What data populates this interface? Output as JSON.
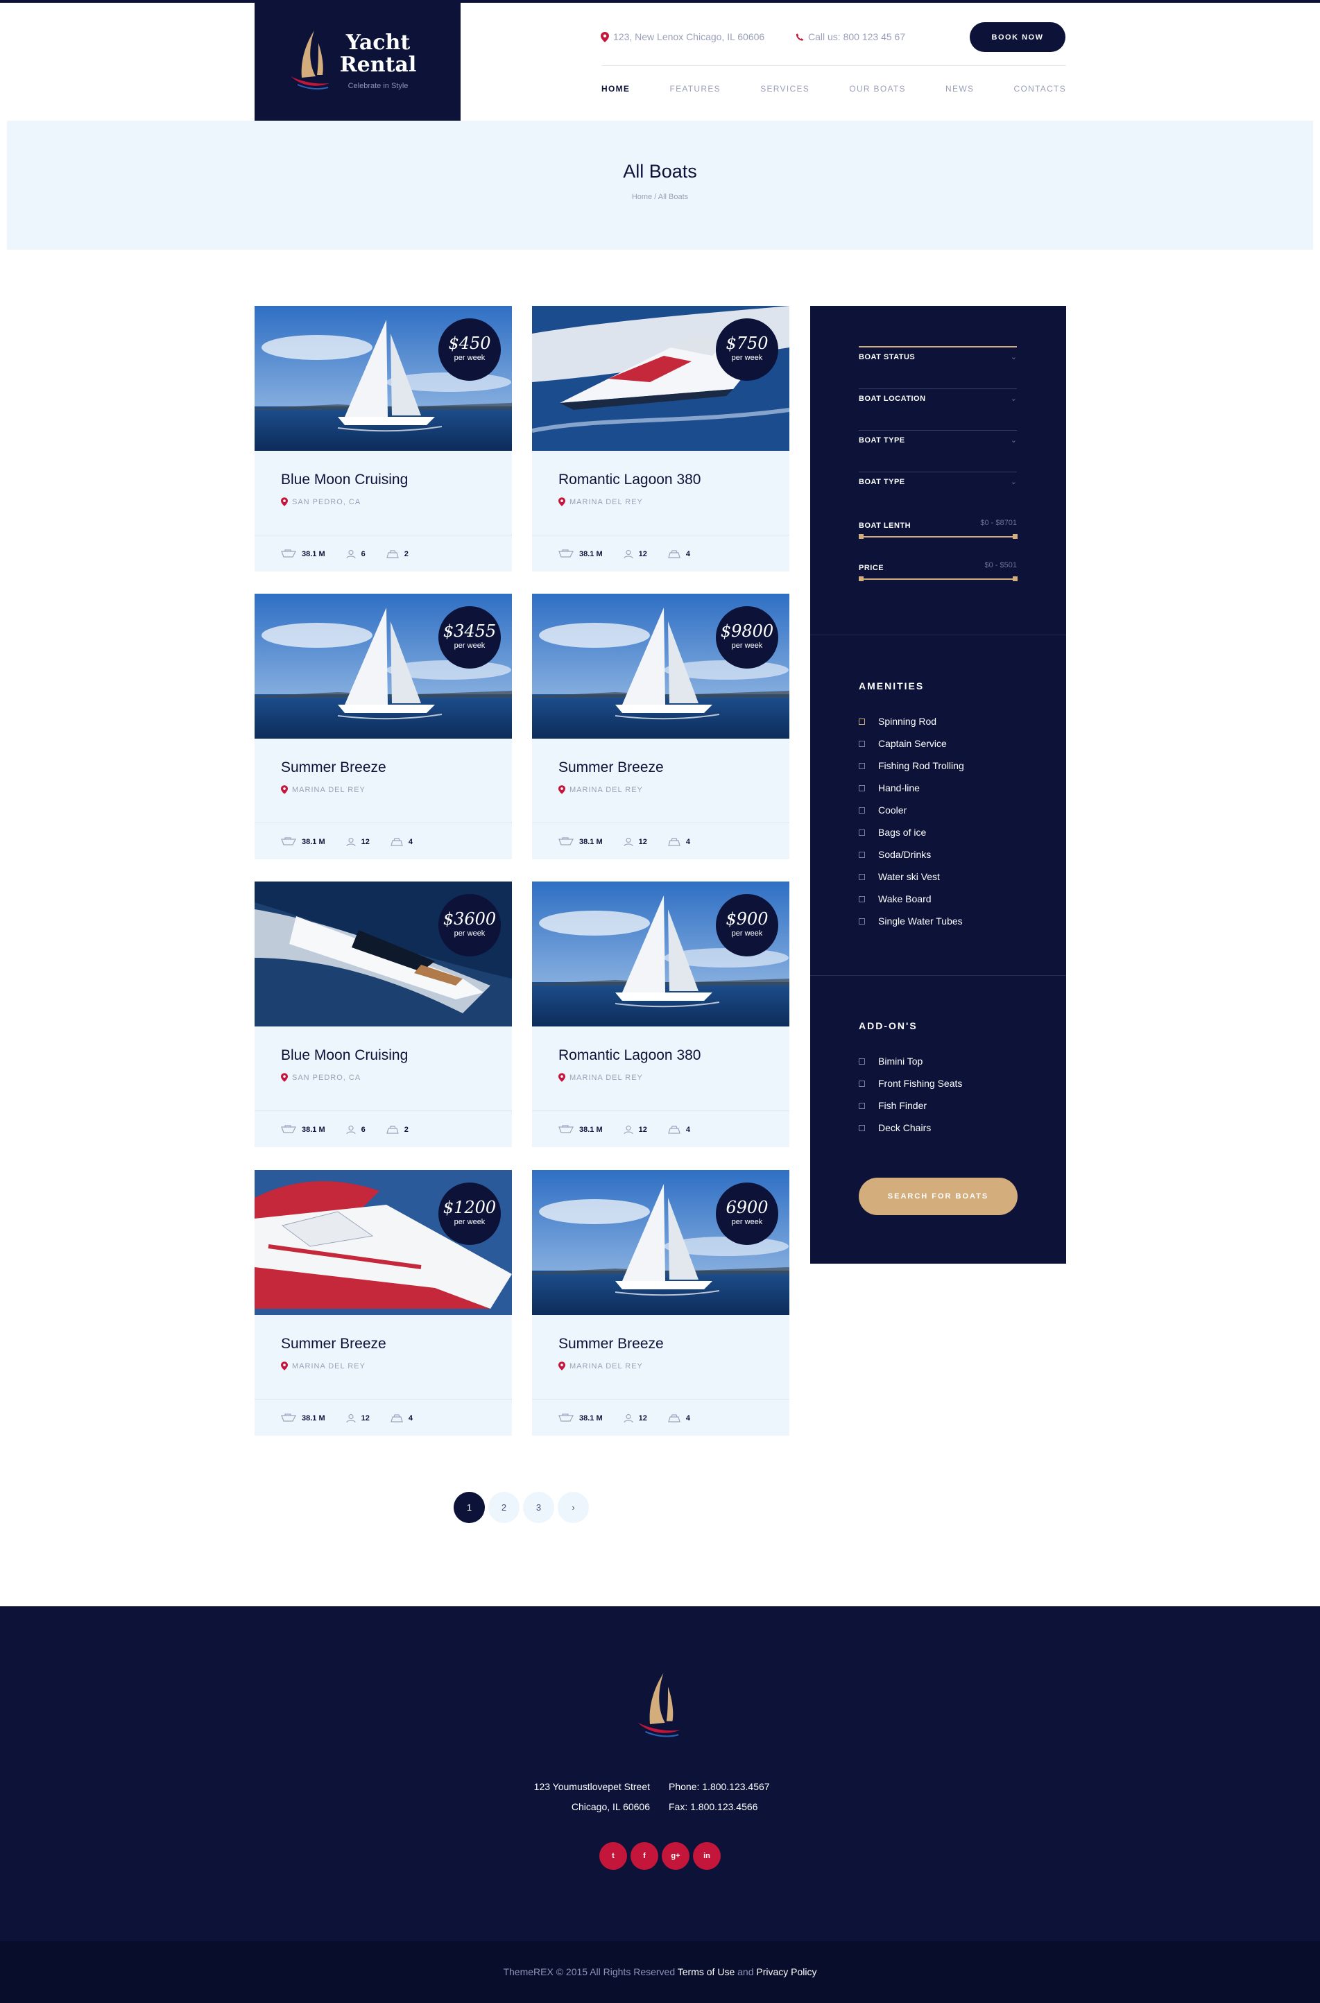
{
  "brand": {
    "name_line1": "Yacht",
    "name_line2": "Rental",
    "tagline": "Celebrate in Style"
  },
  "header": {
    "address": "123, New Lenox Chicago, IL 60606",
    "phone": "Call us: 800 123 45 67",
    "book_label": "BOOK NOW",
    "nav": [
      "HOME",
      "FEATURES",
      "SERVICES",
      "OUR BOATS",
      "NEWS",
      "CONTACTS"
    ],
    "active_nav": "HOME"
  },
  "page": {
    "title": "All Boats",
    "breadcrumb": "Home / All Boats"
  },
  "boats": [
    {
      "name": "Blue Moon Cruising",
      "location": "SAN PEDRO, CA",
      "price": "$450",
      "per": "per week",
      "length": "38.1 M",
      "guests": "6",
      "cabins": "2",
      "image": "sailboat"
    },
    {
      "name": "Romantic Lagoon 380",
      "location": "MARINA DEL REY",
      "price": "$750",
      "per": "per week",
      "length": "38.1 M",
      "guests": "12",
      "cabins": "4",
      "image": "speedboat"
    },
    {
      "name": "Summer Breeze",
      "location": "MARINA DEL REY",
      "price": "$3455",
      "per": "per week",
      "length": "38.1 M",
      "guests": "12",
      "cabins": "4",
      "image": "sailboat"
    },
    {
      "name": "Summer Breeze",
      "location": "MARINA DEL REY",
      "price": "$9800",
      "per": "per week",
      "length": "38.1 M",
      "guests": "12",
      "cabins": "4",
      "image": "sailboat"
    },
    {
      "name": "Blue Moon Cruising",
      "location": "SAN PEDRO, CA",
      "price": "$3600",
      "per": "per week",
      "length": "38.1 M",
      "guests": "6",
      "cabins": "2",
      "image": "yacht"
    },
    {
      "name": "Romantic Lagoon 380",
      "location": "MARINA DEL REY",
      "price": "$900",
      "per": "per week",
      "length": "38.1 M",
      "guests": "12",
      "cabins": "4",
      "image": "sailboat"
    },
    {
      "name": "Summer Breeze",
      "location": "MARINA DEL REY",
      "price": "$1200",
      "per": "per week",
      "length": "38.1 M",
      "guests": "12",
      "cabins": "4",
      "image": "redboat"
    },
    {
      "name": "Summer Breeze",
      "location": "MARINA DEL REY",
      "price": "6900",
      "per": "per week",
      "length": "38.1 M",
      "guests": "12",
      "cabins": "4",
      "image": "sailboat"
    }
  ],
  "filters": {
    "selects": [
      "BOAT STATUS",
      "BOAT LOCATION",
      "BOAT TYPE",
      "BOAT TYPE"
    ],
    "length": {
      "label": "BOAT LENTH",
      "value": "$0 - $8701",
      "fraction": 1.0
    },
    "price": {
      "label": "PRICE",
      "value": "$0 - $501",
      "fraction": 1.0
    },
    "amenities_title": "AMENITIES",
    "amenities": [
      "Spinning Rod",
      "Captain Service",
      "Fishing Rod Trolling",
      "Hand-line",
      "Cooler",
      "Bags of ice",
      "Soda/Drinks",
      "Water ski Vest",
      "Wake Board",
      "Single Water Tubes"
    ],
    "addons_title": "ADD-ON'S",
    "addons": [
      "Bimini Top",
      "Front Fishing Seats",
      "Fish Finder",
      "Deck Chairs"
    ],
    "search_label": "SEARCH FOR BOATS"
  },
  "pagination": {
    "pages": [
      "1",
      "2",
      "3"
    ],
    "next": "›",
    "current": "1"
  },
  "footer": {
    "street": "123 Youmustlovepet Street",
    "city": "Chicago, IL 60606",
    "phone": "Phone: 1.800.123.4567",
    "fax": "Fax: 1.800.123.4566",
    "socials": [
      "t",
      "f",
      "g+",
      "in"
    ],
    "copyright": "ThemeREX © 2015 All Rights Reserved",
    "terms": "Terms of Use",
    "and": "and",
    "privacy": "Privacy Policy"
  },
  "colors": {
    "navy": "#0c1238",
    "gold": "#d4ad7c",
    "red": "#c4163a",
    "light": "#eef6fd"
  }
}
